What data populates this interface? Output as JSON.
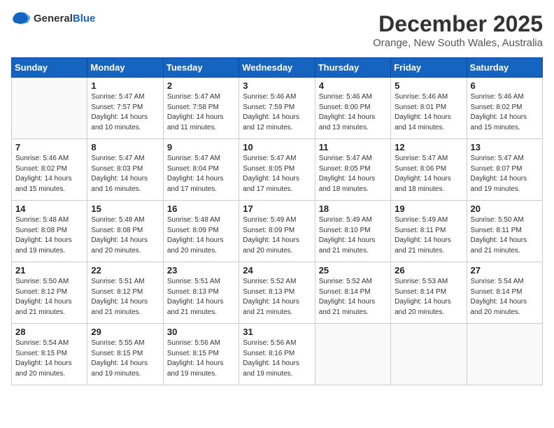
{
  "header": {
    "logo_general": "General",
    "logo_blue": "Blue",
    "month_year": "December 2025",
    "location": "Orange, New South Wales, Australia"
  },
  "days_of_week": [
    "Sunday",
    "Monday",
    "Tuesday",
    "Wednesday",
    "Thursday",
    "Friday",
    "Saturday"
  ],
  "weeks": [
    [
      {
        "day": "",
        "content": ""
      },
      {
        "day": "1",
        "content": "Sunrise: 5:47 AM\nSunset: 7:57 PM\nDaylight: 14 hours\nand 10 minutes."
      },
      {
        "day": "2",
        "content": "Sunrise: 5:47 AM\nSunset: 7:58 PM\nDaylight: 14 hours\nand 11 minutes."
      },
      {
        "day": "3",
        "content": "Sunrise: 5:46 AM\nSunset: 7:59 PM\nDaylight: 14 hours\nand 12 minutes."
      },
      {
        "day": "4",
        "content": "Sunrise: 5:46 AM\nSunset: 8:00 PM\nDaylight: 14 hours\nand 13 minutes."
      },
      {
        "day": "5",
        "content": "Sunrise: 5:46 AM\nSunset: 8:01 PM\nDaylight: 14 hours\nand 14 minutes."
      },
      {
        "day": "6",
        "content": "Sunrise: 5:46 AM\nSunset: 8:02 PM\nDaylight: 14 hours\nand 15 minutes."
      }
    ],
    [
      {
        "day": "7",
        "content": "Sunrise: 5:46 AM\nSunset: 8:02 PM\nDaylight: 14 hours\nand 15 minutes."
      },
      {
        "day": "8",
        "content": "Sunrise: 5:47 AM\nSunset: 8:03 PM\nDaylight: 14 hours\nand 16 minutes."
      },
      {
        "day": "9",
        "content": "Sunrise: 5:47 AM\nSunset: 8:04 PM\nDaylight: 14 hours\nand 17 minutes."
      },
      {
        "day": "10",
        "content": "Sunrise: 5:47 AM\nSunset: 8:05 PM\nDaylight: 14 hours\nand 17 minutes."
      },
      {
        "day": "11",
        "content": "Sunrise: 5:47 AM\nSunset: 8:05 PM\nDaylight: 14 hours\nand 18 minutes."
      },
      {
        "day": "12",
        "content": "Sunrise: 5:47 AM\nSunset: 8:06 PM\nDaylight: 14 hours\nand 18 minutes."
      },
      {
        "day": "13",
        "content": "Sunrise: 5:47 AM\nSunset: 8:07 PM\nDaylight: 14 hours\nand 19 minutes."
      }
    ],
    [
      {
        "day": "14",
        "content": "Sunrise: 5:48 AM\nSunset: 8:08 PM\nDaylight: 14 hours\nand 19 minutes."
      },
      {
        "day": "15",
        "content": "Sunrise: 5:48 AM\nSunset: 8:08 PM\nDaylight: 14 hours\nand 20 minutes."
      },
      {
        "day": "16",
        "content": "Sunrise: 5:48 AM\nSunset: 8:09 PM\nDaylight: 14 hours\nand 20 minutes."
      },
      {
        "day": "17",
        "content": "Sunrise: 5:49 AM\nSunset: 8:09 PM\nDaylight: 14 hours\nand 20 minutes."
      },
      {
        "day": "18",
        "content": "Sunrise: 5:49 AM\nSunset: 8:10 PM\nDaylight: 14 hours\nand 21 minutes."
      },
      {
        "day": "19",
        "content": "Sunrise: 5:49 AM\nSunset: 8:11 PM\nDaylight: 14 hours\nand 21 minutes."
      },
      {
        "day": "20",
        "content": "Sunrise: 5:50 AM\nSunset: 8:11 PM\nDaylight: 14 hours\nand 21 minutes."
      }
    ],
    [
      {
        "day": "21",
        "content": "Sunrise: 5:50 AM\nSunset: 8:12 PM\nDaylight: 14 hours\nand 21 minutes."
      },
      {
        "day": "22",
        "content": "Sunrise: 5:51 AM\nSunset: 8:12 PM\nDaylight: 14 hours\nand 21 minutes."
      },
      {
        "day": "23",
        "content": "Sunrise: 5:51 AM\nSunset: 8:13 PM\nDaylight: 14 hours\nand 21 minutes."
      },
      {
        "day": "24",
        "content": "Sunrise: 5:52 AM\nSunset: 8:13 PM\nDaylight: 14 hours\nand 21 minutes."
      },
      {
        "day": "25",
        "content": "Sunrise: 5:52 AM\nSunset: 8:14 PM\nDaylight: 14 hours\nand 21 minutes."
      },
      {
        "day": "26",
        "content": "Sunrise: 5:53 AM\nSunset: 8:14 PM\nDaylight: 14 hours\nand 20 minutes."
      },
      {
        "day": "27",
        "content": "Sunrise: 5:54 AM\nSunset: 8:14 PM\nDaylight: 14 hours\nand 20 minutes."
      }
    ],
    [
      {
        "day": "28",
        "content": "Sunrise: 5:54 AM\nSunset: 8:15 PM\nDaylight: 14 hours\nand 20 minutes."
      },
      {
        "day": "29",
        "content": "Sunrise: 5:55 AM\nSunset: 8:15 PM\nDaylight: 14 hours\nand 19 minutes."
      },
      {
        "day": "30",
        "content": "Sunrise: 5:56 AM\nSunset: 8:15 PM\nDaylight: 14 hours\nand 19 minutes."
      },
      {
        "day": "31",
        "content": "Sunrise: 5:56 AM\nSunset: 8:16 PM\nDaylight: 14 hours\nand 19 minutes."
      },
      {
        "day": "",
        "content": ""
      },
      {
        "day": "",
        "content": ""
      },
      {
        "day": "",
        "content": ""
      }
    ]
  ]
}
